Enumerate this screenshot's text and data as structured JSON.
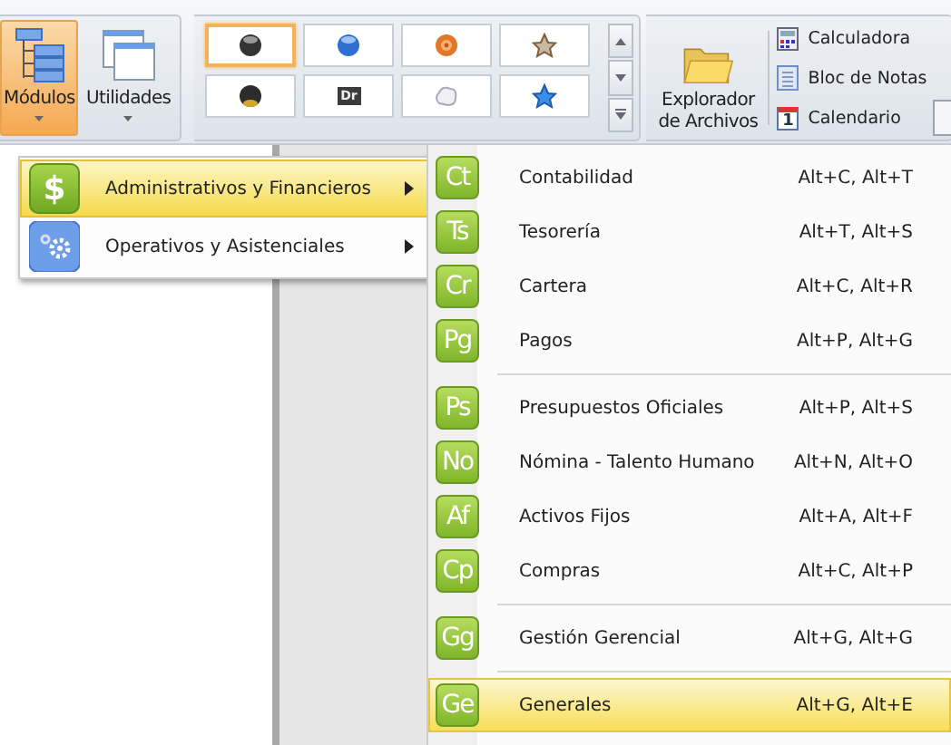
{
  "ribbon": {
    "buttons": [
      {
        "label": "Módulos",
        "kind": "tree",
        "selected": true
      },
      {
        "label": "Utilidades",
        "kind": "windows",
        "selected": false
      }
    ],
    "gallery": [
      {
        "kind": "dark-orb",
        "selected": true
      },
      {
        "kind": "blue-orb",
        "selected": false
      },
      {
        "kind": "orange-disc",
        "selected": false
      },
      {
        "kind": "brown-star",
        "selected": false
      },
      {
        "kind": "gold-orb",
        "selected": false
      },
      {
        "kind": "badge",
        "text": "Dr",
        "selected": false
      },
      {
        "kind": "cloud",
        "selected": false
      },
      {
        "kind": "blue-star",
        "selected": false
      }
    ],
    "explorer": {
      "label": "Explorador\nde Archivos"
    },
    "tools": [
      {
        "label": "Calculadora",
        "kind": "calculator"
      },
      {
        "label": "Bloc de Notas",
        "kind": "notepad"
      },
      {
        "label": "Calendario",
        "kind": "calendar",
        "icon_text": "1"
      }
    ]
  },
  "menu": {
    "items": [
      {
        "label": "Administrativos y Financieros",
        "kind": "money",
        "icon_text": "$",
        "selected": true
      },
      {
        "label": "Operativos y Asistenciales",
        "kind": "gears",
        "selected": false
      }
    ]
  },
  "submenu": {
    "sections": [
      [
        {
          "badge": "Ct",
          "label": "Contabilidad",
          "shortcut": "Alt+C, Alt+T",
          "selected": false
        },
        {
          "badge": "Ts",
          "label": "Tesorería",
          "shortcut": "Alt+T, Alt+S",
          "selected": false
        },
        {
          "badge": "Cr",
          "label": "Cartera",
          "shortcut": "Alt+C, Alt+R",
          "selected": false
        },
        {
          "badge": "Pg",
          "label": "Pagos",
          "shortcut": "Alt+P, Alt+G",
          "selected": false
        }
      ],
      [
        {
          "badge": "Ps",
          "label": "Presupuestos Oficiales",
          "shortcut": "Alt+P, Alt+S",
          "selected": false
        },
        {
          "badge": "No",
          "label": "Nómina - Talento Humano",
          "shortcut": "Alt+N, Alt+O",
          "selected": false
        },
        {
          "badge": "Af",
          "label": "Activos Fijos",
          "shortcut": "Alt+A, Alt+F",
          "selected": false
        },
        {
          "badge": "Cp",
          "label": "Compras",
          "shortcut": "Alt+C, Alt+P",
          "selected": false
        }
      ],
      [
        {
          "badge": "Gg",
          "label": "Gestión Gerencial",
          "shortcut": "Alt+G, Alt+G",
          "selected": false
        }
      ],
      [
        {
          "badge": "Ge",
          "label": "Generales",
          "shortcut": "Alt+G, Alt+E",
          "selected": true
        }
      ]
    ]
  }
}
